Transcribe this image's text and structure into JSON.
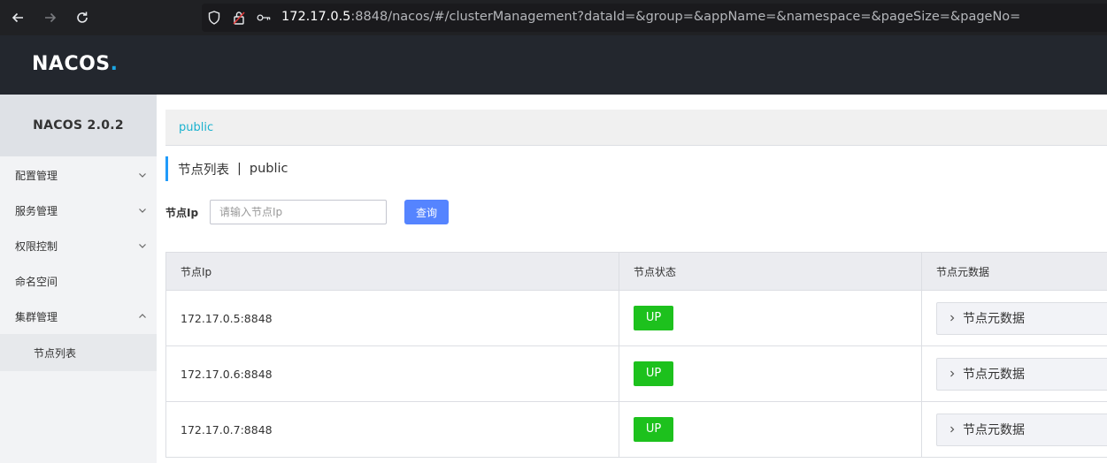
{
  "browser": {
    "url_host": "172.17.0.5",
    "url_rest": ":8848/nacos/#/clusterManagement?dataId=&group=&appName=&namespace=&pageSize=&pageNo=",
    "icons": [
      "back-arrow-icon",
      "forward-arrow-icon",
      "reload-icon",
      "shield-icon",
      "lock-icon",
      "key-icon"
    ]
  },
  "header": {
    "logo_pre": "NAC",
    "logo_o": "O",
    "logo_post": "S",
    "logo_dot": "."
  },
  "sidebar": {
    "title": "NACOS 2.0.2",
    "items": [
      {
        "label": "配置管理",
        "expandable": true,
        "expanded": false
      },
      {
        "label": "服务管理",
        "expandable": true,
        "expanded": false
      },
      {
        "label": "权限控制",
        "expandable": true,
        "expanded": false
      },
      {
        "label": "命名空间",
        "expandable": false
      },
      {
        "label": "集群管理",
        "expandable": true,
        "expanded": true
      }
    ],
    "subitems": [
      {
        "label": "节点列表"
      }
    ]
  },
  "main": {
    "namespace": "public",
    "page_title": "节点列表",
    "page_title_sep": "|",
    "page_title_ns": "public",
    "search": {
      "label": "节点Ip",
      "placeholder": "请输入节点Ip",
      "value": "",
      "button": "查询"
    },
    "table": {
      "columns": [
        "节点Ip",
        "节点状态",
        "节点元数据"
      ],
      "rows": [
        {
          "ip": "172.17.0.5:8848",
          "status": "UP",
          "meta": "节点元数据"
        },
        {
          "ip": "172.17.0.6:8848",
          "status": "UP",
          "meta": "节点元数据"
        },
        {
          "ip": "172.17.0.7:8848",
          "status": "UP",
          "meta": "节点元数据"
        }
      ]
    }
  },
  "colors": {
    "header_bg": "#23272e",
    "accent_blue": "#5584ff",
    "link_teal": "#1ab2cf",
    "status_up": "#1dc11d",
    "title_bar": "#209bfa"
  }
}
